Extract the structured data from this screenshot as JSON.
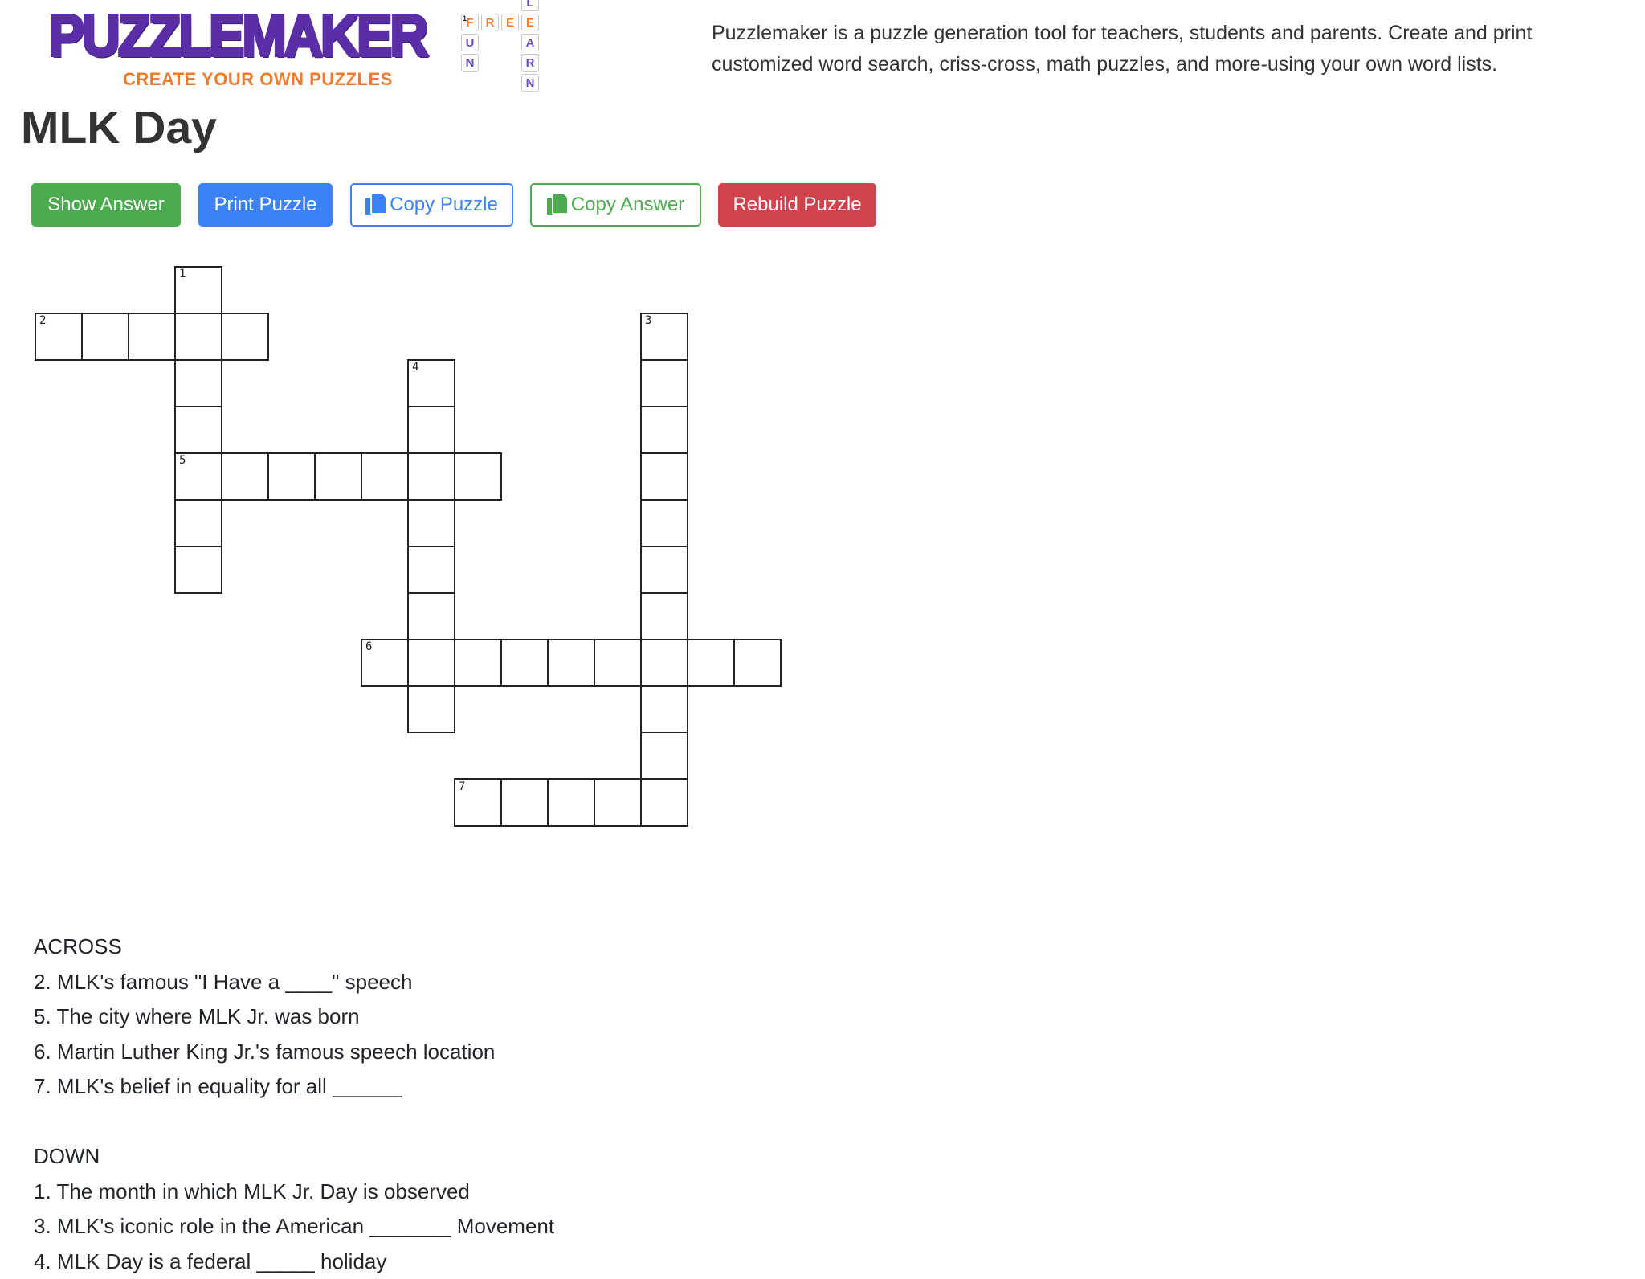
{
  "header": {
    "logo_text": "PUZZLEMAKER",
    "logo_tagline": "CREATE YOUR OWN PUZZLES",
    "mini_crossword": {
      "across_word": "FREE",
      "down_word_1": "FUN",
      "down_word_2": "LEARN",
      "number": "1"
    },
    "description": "Puzzlemaker is a puzzle generation tool for teachers, students and parents. Create and print customized word search, criss-cross, math puzzles, and more-using your own word lists."
  },
  "page_title": "MLK Day",
  "toolbar": {
    "show_answer": "Show Answer",
    "print_puzzle": "Print Puzzle",
    "copy_puzzle": "Copy Puzzle",
    "copy_answer": "Copy Answer",
    "rebuild_puzzle": "Rebuild Puzzle",
    "copy_icon": "copy-icon"
  },
  "colors": {
    "green": "#4caa4f",
    "blue": "#3b82f6",
    "red": "#d0434c",
    "logo_purple": "#5a2ea6",
    "logo_orange": "#ef7b2f"
  },
  "crossword": {
    "rows": 12,
    "cols": 16,
    "entries": [
      {
        "number": "1",
        "direction": "down",
        "row": 0,
        "col": 3,
        "length": 7
      },
      {
        "number": "2",
        "direction": "across",
        "row": 1,
        "col": 0,
        "length": 5
      },
      {
        "number": "3",
        "direction": "down",
        "row": 1,
        "col": 13,
        "length": 11
      },
      {
        "number": "4",
        "direction": "down",
        "row": 2,
        "col": 8,
        "length": 8
      },
      {
        "number": "5",
        "direction": "across",
        "row": 4,
        "col": 3,
        "length": 7
      },
      {
        "number": "6",
        "direction": "across",
        "row": 8,
        "col": 7,
        "length": 9
      },
      {
        "number": "7",
        "direction": "across",
        "row": 11,
        "col": 9,
        "length": 5
      }
    ]
  },
  "clues": {
    "across_heading": "ACROSS",
    "across": [
      "2. MLK's famous \"I Have a ____\" speech",
      "5. The city where MLK Jr. was born",
      "6. Martin Luther King Jr.'s famous speech location",
      "7. MLK's belief in equality for all ______"
    ],
    "down_heading": "DOWN",
    "down": [
      "1. The month in which MLK Jr. Day is observed",
      "3. MLK's iconic role in the American _______ Movement",
      "4. MLK Day is a federal _____ holiday"
    ]
  }
}
